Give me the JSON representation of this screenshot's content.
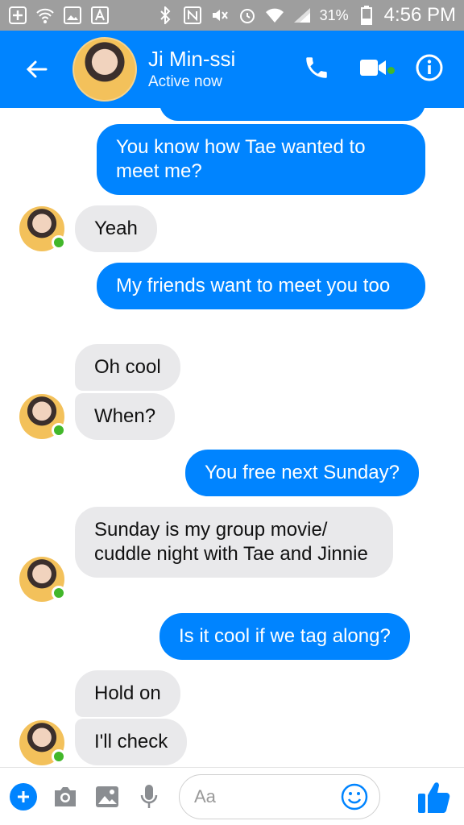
{
  "status_bar": {
    "battery_percent": "31%",
    "time": "4:56 PM"
  },
  "header": {
    "contact_name": "Ji Min-ssi",
    "contact_status": "Active now"
  },
  "messages": [
    {
      "direction": "out",
      "text": "You know how Tae wanted to meet me?"
    },
    {
      "direction": "in",
      "text": "Yeah"
    },
    {
      "direction": "out",
      "text": "My friends want to meet you too"
    },
    {
      "direction": "in",
      "text": "Oh cool"
    },
    {
      "direction": "in",
      "text": "When?"
    },
    {
      "direction": "out",
      "text": "You free next Sunday?"
    },
    {
      "direction": "in",
      "text": "Sunday is my group movie/ cuddle night with Tae and Jinnie"
    },
    {
      "direction": "out",
      "text": "Is it cool if we tag along?"
    },
    {
      "direction": "in",
      "text": "Hold on"
    },
    {
      "direction": "in",
      "text": "I'll check"
    }
  ],
  "composer": {
    "placeholder": "Aa"
  },
  "colors": {
    "accent": "#0084ff",
    "incoming_bubble": "#e9e9eb",
    "online": "#42b72a",
    "status_bar": "#9e9e9e"
  }
}
